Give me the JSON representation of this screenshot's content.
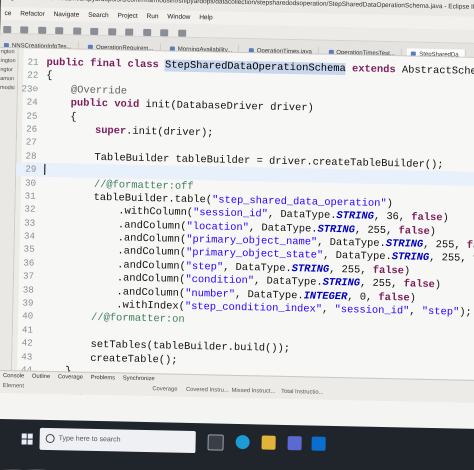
{
  "window": {
    "title": "ogram - console/modsim/shipyardops/src/com/rms/modsim/shipyardops/datacollection/stepsharedodsoperation/StepSharedDataOperationSchema.java - Eclipse IDE"
  },
  "menu": [
    "ce",
    "Refactor",
    "Navigate",
    "Search",
    "Project",
    "Run",
    "Window",
    "Help"
  ],
  "editor_tabs": [
    {
      "label": "NNSCreationInfoTes..."
    },
    {
      "label": "OperationRequirem..."
    },
    {
      "label": "MorningAvailability..."
    },
    {
      "label": "OperationTimes.java"
    },
    {
      "label": "OperationTimesTest..."
    },
    {
      "label": "StepSharedDa"
    }
  ],
  "side_labels": [
    "ngton",
    "ington",
    "ngtor",
    "amon",
    "modsi"
  ],
  "code_lines": [
    {
      "n": "21",
      "parts": [
        [
          "kw",
          "public final class "
        ],
        [
          "hl",
          "StepSharedDataOperationSchema"
        ],
        [
          "kw",
          " extends "
        ],
        [
          "code",
          "AbstractSchema"
        ]
      ]
    },
    {
      "n": "22",
      "parts": [
        [
          "code",
          "{"
        ]
      ]
    },
    {
      "n": "23⊖",
      "parts": [
        [
          "an",
          "    @Override"
        ]
      ]
    },
    {
      "n": "24",
      "parts": [
        [
          "kw",
          "    public void "
        ],
        [
          "code",
          "init(DatabaseDriver driver)"
        ]
      ]
    },
    {
      "n": "25",
      "parts": [
        [
          "code",
          "    {"
        ]
      ]
    },
    {
      "n": "26",
      "parts": [
        [
          "kw",
          "        super"
        ],
        [
          "code",
          ".init(driver);"
        ]
      ]
    },
    {
      "n": "27",
      "parts": [
        [
          "code",
          ""
        ]
      ]
    },
    {
      "n": "28",
      "parts": [
        [
          "code",
          "        TableBuilder tableBuilder = driver.createTableBuilder();"
        ]
      ]
    },
    {
      "n": "29",
      "parts": [
        [
          "code",
          ""
        ]
      ],
      "current": true
    },
    {
      "n": "30",
      "parts": [
        [
          "cm",
          "        //@formatter:off"
        ]
      ]
    },
    {
      "n": "31",
      "parts": [
        [
          "code",
          "        tableBuilder.table("
        ],
        [
          "st",
          "\"step_shared_data_operation\""
        ],
        [
          "code",
          ")"
        ]
      ]
    },
    {
      "n": "32",
      "parts": [
        [
          "code",
          "            .withColumn("
        ],
        [
          "st",
          "\"session_id\""
        ],
        [
          "code",
          ", DataType."
        ],
        [
          "it",
          "STRING"
        ],
        [
          "code",
          ", 36, "
        ],
        [
          "kw",
          "false"
        ],
        [
          "code",
          ")"
        ]
      ]
    },
    {
      "n": "33",
      "parts": [
        [
          "code",
          "            .andColumn("
        ],
        [
          "st",
          "\"location\""
        ],
        [
          "code",
          ", DataType."
        ],
        [
          "it",
          "STRING"
        ],
        [
          "code",
          ", 255, "
        ],
        [
          "kw",
          "false"
        ],
        [
          "code",
          ")"
        ]
      ]
    },
    {
      "n": "34",
      "parts": [
        [
          "code",
          "            .andColumn("
        ],
        [
          "st",
          "\"primary_object_name\""
        ],
        [
          "code",
          ", DataType."
        ],
        [
          "it",
          "STRING"
        ],
        [
          "code",
          ", 255, "
        ],
        [
          "kw",
          "false"
        ],
        [
          "code",
          ")"
        ]
      ]
    },
    {
      "n": "35",
      "parts": [
        [
          "code",
          "            .andColumn("
        ],
        [
          "st",
          "\"primary_object_state\""
        ],
        [
          "code",
          ", DataType."
        ],
        [
          "it",
          "STRING"
        ],
        [
          "code",
          ", 255, "
        ],
        [
          "kw",
          "false"
        ],
        [
          "code",
          ")"
        ]
      ]
    },
    {
      "n": "36",
      "parts": [
        [
          "code",
          "            .andColumn("
        ],
        [
          "st",
          "\"step\""
        ],
        [
          "code",
          ", DataType."
        ],
        [
          "it",
          "STRING"
        ],
        [
          "code",
          ", 255, "
        ],
        [
          "kw",
          "false"
        ],
        [
          "code",
          ")"
        ]
      ]
    },
    {
      "n": "37",
      "parts": [
        [
          "code",
          "            .andColumn("
        ],
        [
          "st",
          "\"condition\""
        ],
        [
          "code",
          ", DataType."
        ],
        [
          "it",
          "STRING"
        ],
        [
          "code",
          ", 255, "
        ],
        [
          "kw",
          "false"
        ],
        [
          "code",
          ")"
        ]
      ]
    },
    {
      "n": "38",
      "parts": [
        [
          "code",
          "            .andColumn("
        ],
        [
          "st",
          "\"number\""
        ],
        [
          "code",
          ", DataType."
        ],
        [
          "it",
          "INTEGER"
        ],
        [
          "code",
          ", 0, "
        ],
        [
          "kw",
          "false"
        ],
        [
          "code",
          ")"
        ]
      ]
    },
    {
      "n": "39",
      "parts": [
        [
          "code",
          "            .withIndex("
        ],
        [
          "st",
          "\"step_condition_index\""
        ],
        [
          "code",
          ", "
        ],
        [
          "st",
          "\"session_id\""
        ],
        [
          "code",
          ", "
        ],
        [
          "st",
          "\"step\""
        ],
        [
          "code",
          ");"
        ]
      ]
    },
    {
      "n": "40",
      "parts": [
        [
          "cm",
          "        //@formatter:on"
        ]
      ]
    },
    {
      "n": "41",
      "parts": [
        [
          "code",
          ""
        ]
      ]
    },
    {
      "n": "42",
      "parts": [
        [
          "code",
          "        setTables(tableBuilder.build());"
        ]
      ]
    },
    {
      "n": "43",
      "parts": [
        [
          "code",
          "        createTable();"
        ]
      ]
    },
    {
      "n": "44",
      "parts": [
        [
          "code",
          "    }"
        ]
      ]
    },
    {
      "n": "45",
      "parts": [
        [
          "code",
          ""
        ]
      ]
    },
    {
      "n": "46⊖",
      "parts": [
        [
          "cm",
          "    /**"
        ]
      ]
    }
  ],
  "bottom_tabs": [
    "Console",
    "Outline",
    "Coverage",
    "Problems",
    "Synchronize"
  ],
  "coverage_columns": [
    "Element",
    "Coverage",
    "Covered Instru...",
    "Missed Instruct...",
    "Total Instructio..."
  ],
  "taskbar": {
    "search_placeholder": "Type here to search"
  },
  "colors": {
    "keyword": "#7d1d5a",
    "string": "#2a00ff",
    "comment": "#3f7f5f",
    "constant": "#0000c0",
    "selection": "#c8d6ee",
    "taskbar": "#20242b"
  }
}
